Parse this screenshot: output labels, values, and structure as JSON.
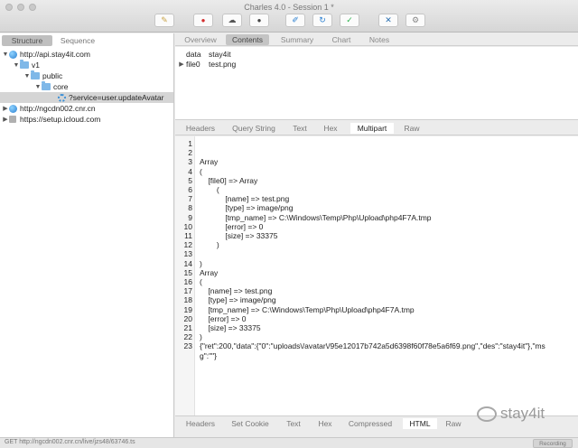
{
  "window": {
    "title": "Charles 4.0 - Session 1 *"
  },
  "toolbar": {
    "icons": [
      "broom-icon",
      "record-icon",
      "turtle-icon",
      "stop-icon",
      "pen-icon",
      "refresh-icon",
      "check-icon",
      "tools-icon",
      "gear-icon"
    ],
    "glyphs": [
      "✎",
      "●",
      "☁",
      "●",
      "✐",
      "↻",
      "✓",
      "✕",
      "⚙"
    ],
    "colors": {
      "record": "#d22b2b",
      "blue": "#2a7fd0",
      "green": "#2bb24c"
    }
  },
  "left_panel": {
    "tabs": [
      "Structure",
      "Sequence"
    ],
    "active_tab": "Structure",
    "tree": [
      {
        "label": "http://api.stay4it.com",
        "expanded": true
      },
      {
        "label": "v1",
        "expanded": true
      },
      {
        "label": "public",
        "expanded": true
      },
      {
        "label": "core",
        "expanded": true
      },
      {
        "label": "?service=user.updateAvatar",
        "selected": true
      },
      {
        "label": "http://ngcdn002.cnr.cn",
        "expanded": false
      },
      {
        "label": "https://setup.icloud.com",
        "expanded": false
      }
    ]
  },
  "top_tabs": [
    "Overview",
    "Contents",
    "Summary",
    "Chart",
    "Notes"
  ],
  "top_active": "Contents",
  "form": [
    {
      "key": "data",
      "value": "stay4it"
    },
    {
      "key": "file0",
      "value": "test.png"
    }
  ],
  "mid_tabs": [
    "Headers",
    "Query String",
    "Text",
    "Hex",
    "Multipart",
    "Raw"
  ],
  "mid_active": "Multipart",
  "code_lines": [
    "",
    "",
    "Array",
    "(",
    "    [file0] => Array",
    "        (",
    "            [name] => test.png",
    "            [type] => image/png",
    "            [tmp_name] => C:\\Windows\\Temp\\Php\\Upload\\php4F7A.tmp",
    "            [error] => 0",
    "            [size] => 33375",
    "        )",
    "",
    ")",
    "Array",
    "(",
    "    [name] => test.png",
    "    [type] => image/png",
    "    [tmp_name] => C:\\Windows\\Temp\\Php\\Upload\\php4F7A.tmp",
    "    [error] => 0",
    "    [size] => 33375",
    ")",
    "{\"ret\":200,\"data\":{\"0\":\"uploads\\/avatar\\/95e12017b742a5d6398f60f78e5a6f69.png\",\"des\":\"stay4it\"},\"ms",
    "g\":\"\"}"
  ],
  "line_numbers": [
    "1",
    "2",
    "3",
    "4",
    "5",
    "6",
    "7",
    "8",
    "9",
    "10",
    "11",
    "12",
    "13",
    "14",
    "15",
    "16",
    "17",
    "18",
    "19",
    "20",
    "21",
    "22",
    "23",
    "",
    ""
  ],
  "bottom_tabs": [
    "Headers",
    "Set Cookie",
    "Text",
    "Hex",
    "Compressed",
    "HTML",
    "Raw"
  ],
  "bottom_active": "HTML",
  "status": {
    "text": "GET http://ngcdn002.cnr.cn/live/jzs48/63746.ts",
    "recording": "Recording"
  },
  "watermark": "stay4it"
}
